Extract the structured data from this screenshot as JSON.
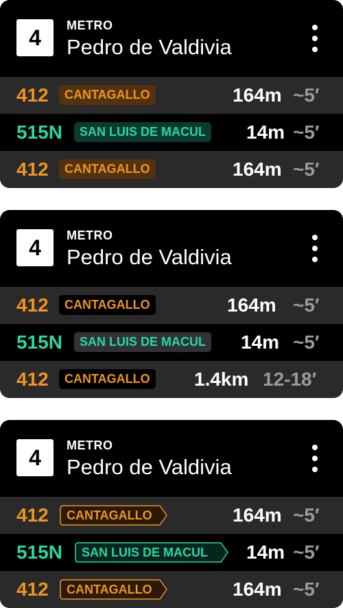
{
  "colors": {
    "orange": "#f0941f",
    "green": "#29d7a4",
    "gray_eta": "#9a9a9a"
  },
  "cards": [
    {
      "badge": "4",
      "kicker": "METRO",
      "station": "Pedro de Valdivia",
      "menu_icon": "more-vertical-icon",
      "rows": [
        {
          "route": "412",
          "destination": "CANTAGALLO",
          "distance": "164m",
          "eta": "~5′"
        },
        {
          "route": "515N",
          "destination": "SAN LUIS DE MACUL",
          "distance": "14m",
          "eta": "~5′"
        },
        {
          "route": "412",
          "destination": "CANTAGALLO",
          "distance": "164m",
          "eta": "~5′"
        }
      ]
    },
    {
      "badge": "4",
      "kicker": "METRO",
      "station": "Pedro de Valdivia",
      "menu_icon": "more-vertical-icon",
      "rows": [
        {
          "route": "412",
          "destination": "CANTAGALLO",
          "distance": "164m",
          "eta": "~5′"
        },
        {
          "route": "515N",
          "destination": "SAN LUIS DE MACUL",
          "distance": "14m",
          "eta": "~5′"
        },
        {
          "route": "412",
          "destination": "CANTAGALLO",
          "distance": "1.4km",
          "eta": "12-18′"
        }
      ]
    },
    {
      "badge": "4",
      "kicker": "METRO",
      "station": "Pedro de Valdivia",
      "menu_icon": "more-vertical-icon",
      "rows": [
        {
          "route": "412",
          "destination": "CANTAGALLO",
          "distance": "164m",
          "eta": "~5′"
        },
        {
          "route": "515N",
          "destination": "SAN LUIS DE MACUL",
          "distance": "14m",
          "eta": "~5′"
        },
        {
          "route": "412",
          "destination": "CANTAGALLO",
          "distance": "164m",
          "eta": "~5′"
        }
      ]
    }
  ]
}
